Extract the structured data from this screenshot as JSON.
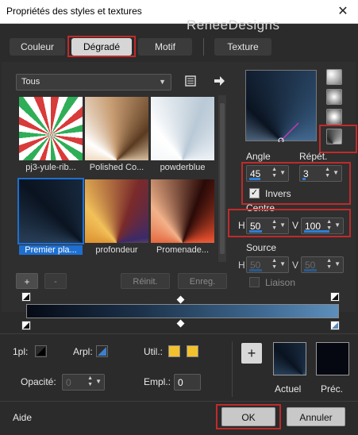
{
  "window": {
    "title": "Propriétés des styles et textures",
    "close_glyph": "✕"
  },
  "watermark": "ReneeDesigns",
  "tabs": [
    {
      "label": "Couleur",
      "active": false
    },
    {
      "label": "Dégradé",
      "active": true
    },
    {
      "label": "Motif",
      "active": false
    },
    {
      "label": "Texture",
      "active": false
    }
  ],
  "library": {
    "category": "Tous",
    "items": [
      {
        "label": "pj3-yule-rib...",
        "selected": false
      },
      {
        "label": "Polished Co...",
        "selected": false
      },
      {
        "label": "powderblue",
        "selected": false
      },
      {
        "label": "Premier pla...",
        "selected": true
      },
      {
        "label": "profondeur",
        "selected": false
      },
      {
        "label": "Promenade...",
        "selected": false
      }
    ],
    "add_label": "+",
    "remove_label": "-",
    "reset_label": "Réinit.",
    "save_label": "Enreg."
  },
  "gradient_settings": {
    "angle_label": "Angle",
    "angle_value": "45",
    "repeat_label": "Répét.",
    "repeat_value": "3",
    "invert_label": "Invers",
    "invert_checked": true,
    "center_label": "Centre",
    "center_h_label": "H",
    "center_h_value": "50",
    "center_v_label": "V",
    "center_v_value": "100",
    "source_label": "Source",
    "source_h_label": "H",
    "source_h_value": "50",
    "source_v_label": "V",
    "source_v_value": "50",
    "link_label": "Liaison",
    "link_checked": false
  },
  "stop_settings": {
    "opacity_stop_label": "1pl:",
    "background_stop_label": "Arpl:",
    "use_label": "Util.:",
    "use_color": "#f2c12e",
    "opacity_label": "Opacité:",
    "opacity_value": "0",
    "location_label": "Empl.:",
    "location_value": "0"
  },
  "previews": {
    "add_label": "+",
    "current_label": "Actuel",
    "previous_label": "Préc."
  },
  "footer": {
    "help_label": "Aide",
    "ok_label": "OK",
    "cancel_label": "Annuler"
  },
  "colors": {
    "accent": "#1e6fd0",
    "highlight_red": "#c02a2a",
    "dialog_bg": "#2b2b2b"
  }
}
